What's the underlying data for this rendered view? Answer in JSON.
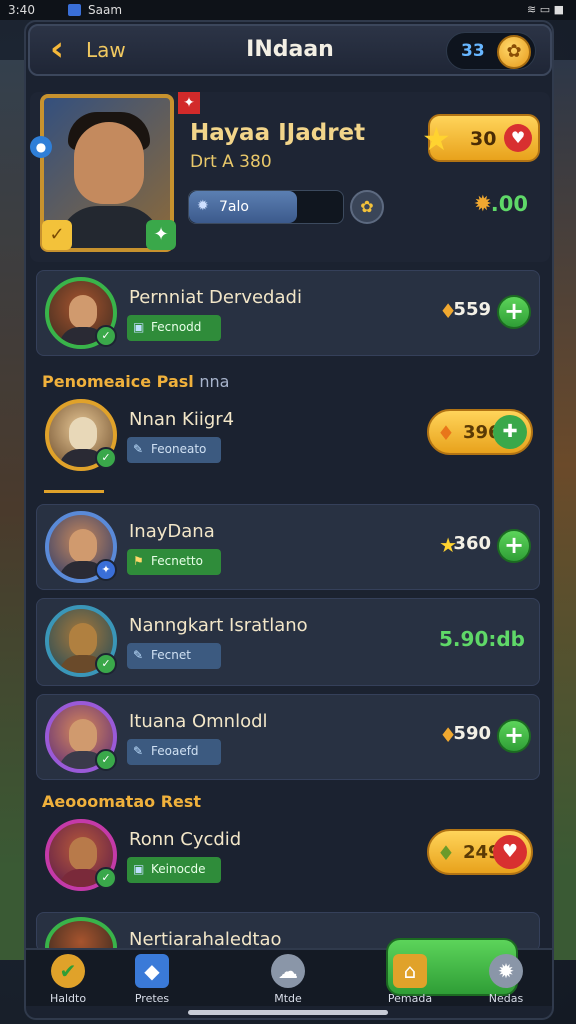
{
  "status_bar": {
    "time": "3:40",
    "app": "Saam",
    "right": "≋ ▭ ■"
  },
  "header": {
    "left_label": "Law",
    "title": "INdaan",
    "currency": "33",
    "coin_icon": "gold-coin"
  },
  "profile": {
    "name": "Hayaa IJadret",
    "rank": "Drt A 380",
    "progress_label": "7alo",
    "progress_fraction": 0.7,
    "stars_value": "30",
    "gear_value": ".00"
  },
  "section_labels": {
    "first": "Penomeaice Pasl",
    "first_extra": "nna",
    "second": "Aeooomatao Rest"
  },
  "rows": [
    {
      "name": "Pernniat Dervedadi",
      "tag": "Fecnodd",
      "value": "559",
      "icon": "flame-icon",
      "action": "plus"
    },
    {
      "name": "Nnan Kiigr4",
      "tag": "Feoneato",
      "value": "396",
      "icon": "flame-icon",
      "action": "gold-plus"
    },
    {
      "name": "InayDana",
      "tag": "Fecnetto",
      "value": "360",
      "icon": "star-icon",
      "action": "plus"
    },
    {
      "name": "Nanngkart Isratlano",
      "tag": "Fecnet",
      "value": "5.90:db",
      "icon": "none",
      "action": "green-value"
    },
    {
      "name": "Ituana Omnlodl",
      "tag": "Feoaefd",
      "value": "590",
      "icon": "flame-icon",
      "action": "plus"
    },
    {
      "name": "Ronn Cycdid",
      "tag": "Keinocde",
      "value": "249",
      "icon": "flame-icon",
      "action": "gold-heart"
    },
    {
      "name": "Nertiarahaledtao"
    }
  ],
  "bottom_nav": [
    {
      "label": "Haldto",
      "icon": "check-icon"
    },
    {
      "label": "Pretes",
      "icon": "gem-icon"
    },
    {
      "label": "Mtde",
      "icon": "chat-icon"
    },
    {
      "label": "Pemada",
      "icon": "shop-icon"
    },
    {
      "label": "Nedas",
      "icon": "gear-icon"
    }
  ]
}
